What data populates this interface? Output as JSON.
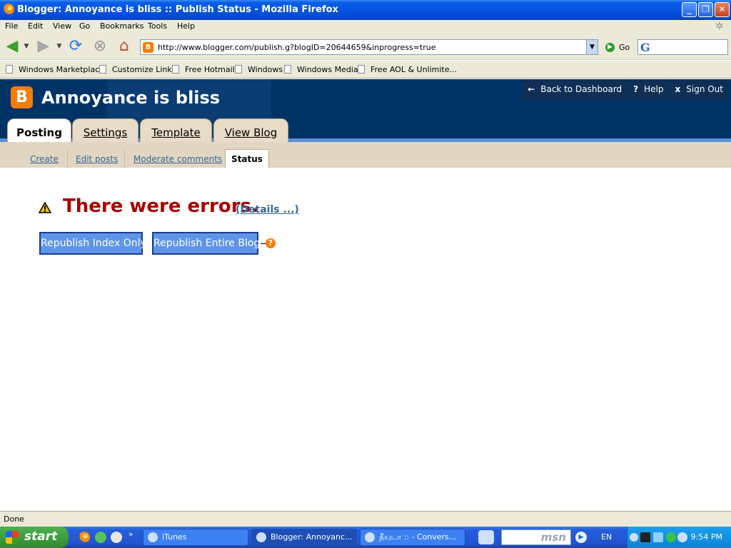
{
  "window": {
    "title": "Blogger: Annoyance is bliss :: Publish Status - Mozilla Firefox",
    "minimize": "_",
    "maximize": "❐",
    "close": "✕"
  },
  "menu": [
    "File",
    "Edit",
    "View",
    "Go",
    "Bookmarks",
    "Tools",
    "Help"
  ],
  "nav": {
    "url": "http://www.blogger.com/publish.g?blogID=20644659&inprogress=true",
    "go_label": "Go"
  },
  "bookmarks": [
    "Windows Marketplace",
    "Customize Links",
    "Free Hotmail",
    "Windows",
    "Windows Media",
    "Free AOL & Unlimite..."
  ],
  "blog": {
    "name": "Annoyance is bliss",
    "top_links": [
      {
        "icon": "←",
        "label": "Back to Dashboard"
      },
      {
        "icon": "?",
        "label": "Help"
      },
      {
        "icon": "x",
        "label": "Sign Out"
      }
    ],
    "tabs": [
      "Posting",
      "Settings",
      "Template",
      "View Blog"
    ],
    "subtabs": [
      "Create",
      "Edit posts",
      "Moderate comments",
      "Status"
    ]
  },
  "content": {
    "error_message": "There were errors.",
    "details_link": "(Details ...)",
    "republish_index": "Republish Index Only",
    "republish_entire": "Republish Entire Blog",
    "help_icon": "?"
  },
  "status": {
    "text": "Done"
  },
  "taskbar": {
    "start": "start",
    "tasks": [
      "iTunes",
      "Blogger: Annoyanc...",
      "தீயுடா :: - Convers..."
    ],
    "language": "EN",
    "time": "9:54 PM",
    "msn": "msn"
  },
  "colors": {
    "blogger_header": "#003366",
    "tab_bg": "#e8dcc8",
    "error_red": "#aa0000",
    "link_blue": "#336699",
    "button_blue": "#5e95e8",
    "blogger_orange": "#f57d00"
  }
}
